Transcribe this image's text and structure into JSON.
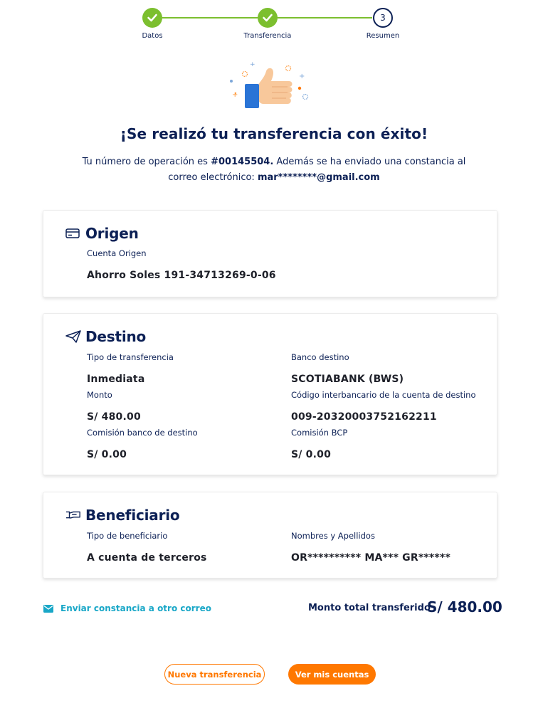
{
  "stepper": {
    "steps": [
      {
        "label": "Datos",
        "state": "done"
      },
      {
        "label": "Transferencia",
        "state": "done"
      },
      {
        "label": "Resumen",
        "state": "current",
        "number": "3"
      }
    ]
  },
  "header": {
    "title": "¡Se realizó tu transferencia con éxito!",
    "desc_prefix": "Tu número de operación es ",
    "operation_number": "#00145504.",
    "desc_middle": " Además se ha enviado una constancia al correo electrónico: ",
    "email": "mar********@gmail.com"
  },
  "origen": {
    "title": "Origen",
    "icon": "card-icon",
    "account_label": "Cuenta Origen",
    "account_value": "Ahorro Soles 191-34713269-0-06"
  },
  "destino": {
    "title": "Destino",
    "icon": "paper-plane-icon",
    "tipo_label": "Tipo de transferencia",
    "tipo_value": "Inmediata",
    "banco_label": "Banco destino",
    "banco_value": "SCOTIABANK (BWS)",
    "monto_label": "Monto",
    "monto_value": "S/ 480.00",
    "cci_label": "Código interbancario de la cuenta de destino",
    "cci_value": "009-20320003752162211",
    "comision_dest_label": "Comisión banco de destino",
    "comision_dest_value": "S/ 0.00",
    "comision_bcp_label": "Comisión BCP",
    "comision_bcp_value": "S/ 0.00"
  },
  "beneficiario": {
    "title": "Beneficiario",
    "icon": "hand-card-icon",
    "tipo_label": "Tipo de beneficiario",
    "tipo_value": "A cuenta de terceros",
    "nombres_label": "Nombres y Apellidos",
    "nombres_value": "OR********** MA*** GR******"
  },
  "footer": {
    "send_link": "Enviar constancia a otro correo",
    "total_label": "Monto total transferido",
    "total_value": "S/ 480.00"
  },
  "actions": {
    "new_transfer": "Nueva transferencia",
    "view_accounts": "Ver mis cuentas"
  },
  "colors": {
    "primary": "#0c2055",
    "success": "#7cbf2f",
    "accent": "#ff7800",
    "link": "#19a7c7"
  }
}
